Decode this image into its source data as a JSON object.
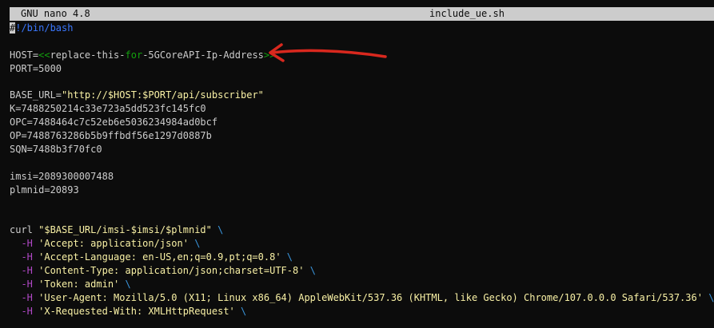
{
  "terminal": {
    "title": {
      "app": "GNU nano 4.8",
      "file": "include_ue.sh"
    }
  },
  "editor": {
    "lines": [
      [
        {
          "text": "#",
          "cls": "cursor"
        },
        {
          "text": "!/bin/bash",
          "cls": "cmt"
        }
      ],
      [],
      [
        {
          "text": "HOST=",
          "cls": "plain"
        },
        {
          "text": "<<",
          "cls": "val"
        },
        {
          "text": "replace-this-",
          "cls": "plain"
        },
        {
          "text": "for",
          "cls": "val"
        },
        {
          "text": "-5GCoreAPI-Ip-Address",
          "cls": "plain"
        },
        {
          "text": ">>",
          "cls": "val"
        }
      ],
      [
        {
          "text": "PORT=5000",
          "cls": "plain"
        }
      ],
      [],
      [
        {
          "text": "BASE_URL=",
          "cls": "plain"
        },
        {
          "text": "\"http://$HOST:$PORT/api/subscriber\"",
          "cls": "str"
        }
      ],
      [
        {
          "text": "K=7488250214c33e723a5dd523fc145fc0",
          "cls": "plain"
        }
      ],
      [
        {
          "text": "OPC=7488464c7c52eb6e5036234984ad0bcf",
          "cls": "plain"
        }
      ],
      [
        {
          "text": "OP=7488763286b5b9ffbdf56e1297d0887b",
          "cls": "plain"
        }
      ],
      [
        {
          "text": "SQN=7488b3f70fc0",
          "cls": "plain"
        }
      ],
      [],
      [
        {
          "text": "imsi=2089300007488",
          "cls": "plain"
        }
      ],
      [
        {
          "text": "plmnid=20893",
          "cls": "plain"
        }
      ],
      [],
      [],
      [
        {
          "text": "curl ",
          "cls": "plain"
        },
        {
          "text": "\"$BASE_URL/imsi-$imsi/$plmnid\"",
          "cls": "str"
        },
        {
          "text": " \\",
          "cls": "esc"
        }
      ],
      [
        {
          "text": "  -H ",
          "cls": "flag"
        },
        {
          "text": "'Accept: application/json'",
          "cls": "str"
        },
        {
          "text": " \\",
          "cls": "esc"
        }
      ],
      [
        {
          "text": "  -H ",
          "cls": "flag"
        },
        {
          "text": "'Accept-Language: en-US,en;q=0.9,pt;q=0.8'",
          "cls": "str"
        },
        {
          "text": " \\",
          "cls": "esc"
        }
      ],
      [
        {
          "text": "  -H ",
          "cls": "flag"
        },
        {
          "text": "'Content-Type: application/json;charset=UTF-8'",
          "cls": "str"
        },
        {
          "text": " \\",
          "cls": "esc"
        }
      ],
      [
        {
          "text": "  -H ",
          "cls": "flag"
        },
        {
          "text": "'Token: admin'",
          "cls": "str"
        },
        {
          "text": " \\",
          "cls": "esc"
        }
      ],
      [
        {
          "text": "  -H ",
          "cls": "flag"
        },
        {
          "text": "'User-Agent: Mozilla/5.0 (X11; Linux x86_64) AppleWebKit/537.36 (KHTML, like Gecko) Chrome/107.0.0.0 Safari/537.36'",
          "cls": "str"
        },
        {
          "text": " \\",
          "cls": "esc"
        }
      ],
      [
        {
          "text": "  -H ",
          "cls": "flag"
        },
        {
          "text": "'X-Requested-With: XMLHttpRequest'",
          "cls": "str"
        },
        {
          "text": " \\",
          "cls": "esc"
        }
      ]
    ]
  },
  "annotation": {
    "arrow_color": "#d9281e"
  },
  "colors": {
    "background": "#0c0c0c",
    "text": "#cccccc",
    "titlebar": "#cccccc",
    "comment": "#3b78ff",
    "value": "#13a10e",
    "string": "#f9f1a5",
    "flag": "#b148c6",
    "escape": "#3a96dd"
  }
}
